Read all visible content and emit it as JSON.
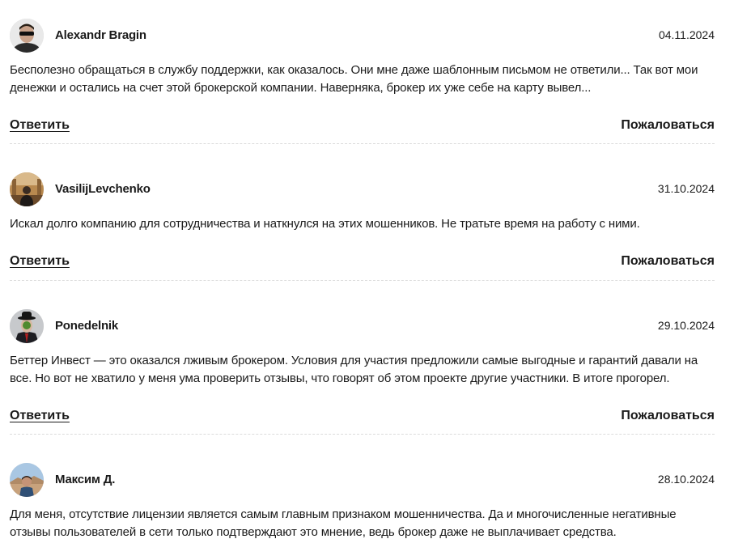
{
  "reply_label": "Ответить",
  "complain_label": "Пожаловаться",
  "comments": [
    {
      "author": "Alexandr Bragin",
      "date": "04.11.2024",
      "text": "Бесполезно обращаться в службу поддержки, как оказалось. Они мне даже шаблонным письмом не ответили... Так вот мои денежки и остались на счет этой брокерской компании. Наверняка, брокер их уже себе на карту вывел..."
    },
    {
      "author": "VasilijLevchenko",
      "date": "31.10.2024",
      "text": "Искал долго компанию для сотрудничества и наткнулся на этих мошенников. Не тратьте время на работу с ними."
    },
    {
      "author": "Ponedelnik",
      "date": "29.10.2024",
      "text": "Беттер Инвест — это оказался лживым брокером. Условия для участия предложили самые выгодные и гарантий давали на все. Но вот не хватило у меня ума проверить отзывы, что говорят об этом проекте другие участники. В итоге прогорел."
    },
    {
      "author": "Максим Д.",
      "date": "28.10.2024",
      "text": "Для меня, отсутствие лицензии является самым главным признаком мошенничества. Да и многочисленные негативные отзывы пользователей в сети только подтверждают это мнение, ведь брокер даже не выплачивает средства."
    }
  ]
}
